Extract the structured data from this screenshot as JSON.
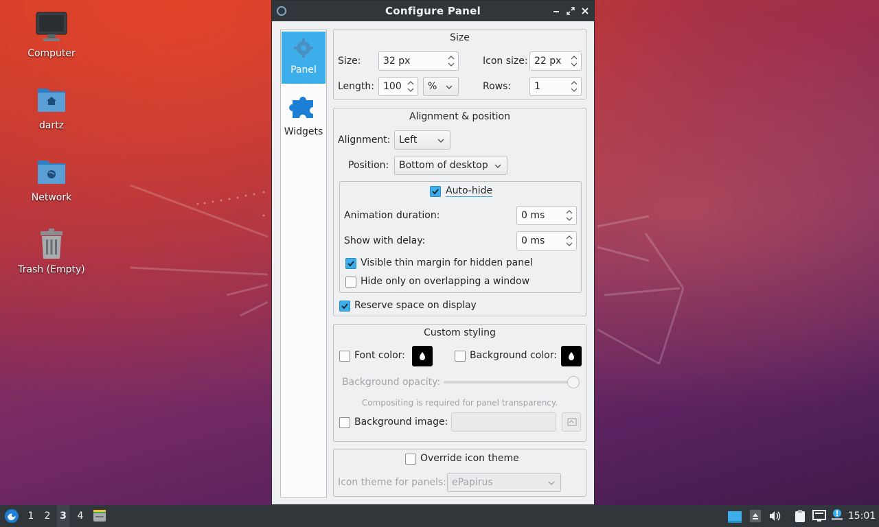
{
  "desktop": {
    "icons": [
      {
        "label": "Computer"
      },
      {
        "label": "dartz"
      },
      {
        "label": "Network"
      },
      {
        "label": "Trash (Empty)"
      }
    ]
  },
  "window": {
    "title": "Configure Panel",
    "sidebar": [
      {
        "label": "Panel",
        "icon": "gear-icon",
        "active": true
      },
      {
        "label": "Widgets",
        "icon": "puzzle-icon",
        "active": false
      }
    ],
    "size_group": {
      "title": "Size",
      "size_label": "Size:",
      "size_value": "32 px",
      "icon_size_label": "Icon size:",
      "icon_size_value": "22 px",
      "length_label": "Length:",
      "length_value": "100",
      "length_unit": "%",
      "rows_label": "Rows:",
      "rows_value": "1"
    },
    "alignment_group": {
      "title": "Alignment & position",
      "alignment_label": "Alignment:",
      "alignment_value": "Left",
      "position_label": "Position:",
      "position_value": "Bottom of desktop",
      "autohide_label": "Auto-hide",
      "autohide_checked": true,
      "animation_label": "Animation duration:",
      "animation_value": "0 ms",
      "delay_label": "Show with delay:",
      "delay_value": "0 ms",
      "thin_margin_label": "Visible thin margin for hidden panel",
      "thin_margin_checked": true,
      "overlap_label": "Hide only on overlapping a window",
      "overlap_checked": false,
      "reserve_label": "Reserve space on display",
      "reserve_checked": true
    },
    "styling_group": {
      "title": "Custom styling",
      "font_color_label": "Font color:",
      "bg_color_label": "Background color:",
      "opacity_label": "Background opacity:",
      "opacity_level": 1.0,
      "compositing_note": "Compositing is required for panel transparency.",
      "bg_image_label": "Background image:",
      "bg_image_value": ""
    },
    "icon_theme_group": {
      "override_label": "Override icon theme",
      "theme_label": "Icon theme for panels:",
      "theme_value": "ePapirus"
    }
  },
  "taskbar": {
    "workspaces": [
      "1",
      "2",
      "3",
      "4"
    ],
    "active_workspace": "3",
    "clock": "15:01"
  },
  "colors": {
    "accent": "#3daee9",
    "titlebar": "#31363b",
    "window_bg": "#eff0f1"
  }
}
